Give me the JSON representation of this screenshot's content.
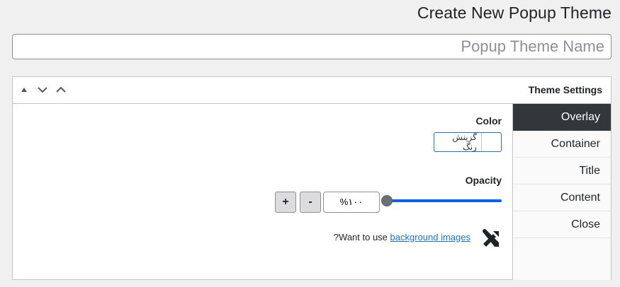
{
  "page": {
    "title": "Create New Popup Theme",
    "name_placeholder": "Popup Theme Name"
  },
  "settings": {
    "title": "Theme Settings",
    "handle_icons": [
      "triangle-up-icon",
      "chevron-down-icon",
      "chevron-up-icon"
    ],
    "tabs": [
      {
        "label": "Overlay",
        "active": true
      },
      {
        "label": "Container",
        "active": false
      },
      {
        "label": "Title",
        "active": false
      },
      {
        "label": "Content",
        "active": false
      },
      {
        "label": "Close",
        "active": false
      }
    ]
  },
  "overlay": {
    "color_label": "Color",
    "color_picker_text": "گزینش رنگ",
    "opacity_label": "Opacity",
    "opacity_value": "%۱۰۰",
    "opacity_level": 1.0,
    "plus_label": "+",
    "minus_label": "-",
    "bg_question_suffix": "?Want to use ",
    "bg_link": "background images"
  },
  "colors": {
    "active_tab": "#32373c",
    "accent": "#2271b1",
    "slider": "#0a60e0"
  }
}
